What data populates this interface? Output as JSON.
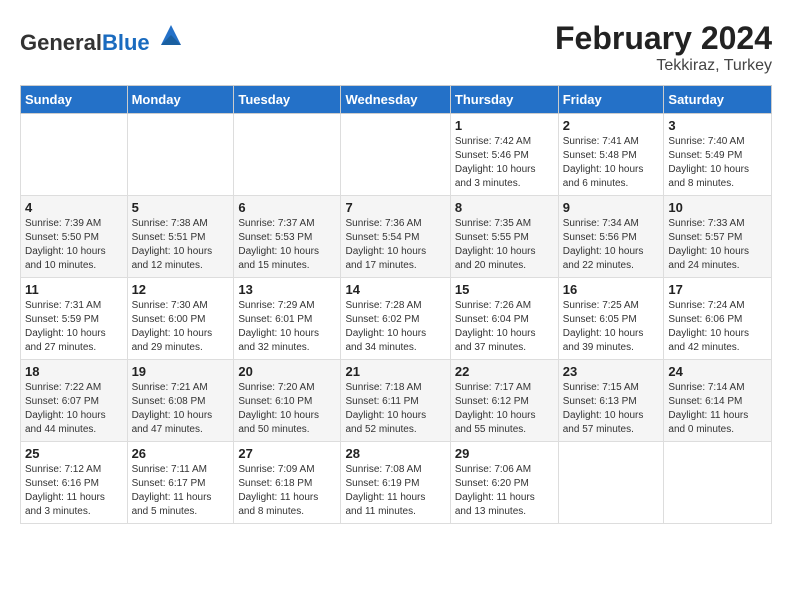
{
  "header": {
    "logo_general": "General",
    "logo_blue": "Blue",
    "month_year": "February 2024",
    "location": "Tekkiraz, Turkey"
  },
  "days_of_week": [
    "Sunday",
    "Monday",
    "Tuesday",
    "Wednesday",
    "Thursday",
    "Friday",
    "Saturday"
  ],
  "weeks": [
    [
      {
        "day": "",
        "info": ""
      },
      {
        "day": "",
        "info": ""
      },
      {
        "day": "",
        "info": ""
      },
      {
        "day": "",
        "info": ""
      },
      {
        "day": "1",
        "info": "Sunrise: 7:42 AM\nSunset: 5:46 PM\nDaylight: 10 hours\nand 3 minutes."
      },
      {
        "day": "2",
        "info": "Sunrise: 7:41 AM\nSunset: 5:48 PM\nDaylight: 10 hours\nand 6 minutes."
      },
      {
        "day": "3",
        "info": "Sunrise: 7:40 AM\nSunset: 5:49 PM\nDaylight: 10 hours\nand 8 minutes."
      }
    ],
    [
      {
        "day": "4",
        "info": "Sunrise: 7:39 AM\nSunset: 5:50 PM\nDaylight: 10 hours\nand 10 minutes."
      },
      {
        "day": "5",
        "info": "Sunrise: 7:38 AM\nSunset: 5:51 PM\nDaylight: 10 hours\nand 12 minutes."
      },
      {
        "day": "6",
        "info": "Sunrise: 7:37 AM\nSunset: 5:53 PM\nDaylight: 10 hours\nand 15 minutes."
      },
      {
        "day": "7",
        "info": "Sunrise: 7:36 AM\nSunset: 5:54 PM\nDaylight: 10 hours\nand 17 minutes."
      },
      {
        "day": "8",
        "info": "Sunrise: 7:35 AM\nSunset: 5:55 PM\nDaylight: 10 hours\nand 20 minutes."
      },
      {
        "day": "9",
        "info": "Sunrise: 7:34 AM\nSunset: 5:56 PM\nDaylight: 10 hours\nand 22 minutes."
      },
      {
        "day": "10",
        "info": "Sunrise: 7:33 AM\nSunset: 5:57 PM\nDaylight: 10 hours\nand 24 minutes."
      }
    ],
    [
      {
        "day": "11",
        "info": "Sunrise: 7:31 AM\nSunset: 5:59 PM\nDaylight: 10 hours\nand 27 minutes."
      },
      {
        "day": "12",
        "info": "Sunrise: 7:30 AM\nSunset: 6:00 PM\nDaylight: 10 hours\nand 29 minutes."
      },
      {
        "day": "13",
        "info": "Sunrise: 7:29 AM\nSunset: 6:01 PM\nDaylight: 10 hours\nand 32 minutes."
      },
      {
        "day": "14",
        "info": "Sunrise: 7:28 AM\nSunset: 6:02 PM\nDaylight: 10 hours\nand 34 minutes."
      },
      {
        "day": "15",
        "info": "Sunrise: 7:26 AM\nSunset: 6:04 PM\nDaylight: 10 hours\nand 37 minutes."
      },
      {
        "day": "16",
        "info": "Sunrise: 7:25 AM\nSunset: 6:05 PM\nDaylight: 10 hours\nand 39 minutes."
      },
      {
        "day": "17",
        "info": "Sunrise: 7:24 AM\nSunset: 6:06 PM\nDaylight: 10 hours\nand 42 minutes."
      }
    ],
    [
      {
        "day": "18",
        "info": "Sunrise: 7:22 AM\nSunset: 6:07 PM\nDaylight: 10 hours\nand 44 minutes."
      },
      {
        "day": "19",
        "info": "Sunrise: 7:21 AM\nSunset: 6:08 PM\nDaylight: 10 hours\nand 47 minutes."
      },
      {
        "day": "20",
        "info": "Sunrise: 7:20 AM\nSunset: 6:10 PM\nDaylight: 10 hours\nand 50 minutes."
      },
      {
        "day": "21",
        "info": "Sunrise: 7:18 AM\nSunset: 6:11 PM\nDaylight: 10 hours\nand 52 minutes."
      },
      {
        "day": "22",
        "info": "Sunrise: 7:17 AM\nSunset: 6:12 PM\nDaylight: 10 hours\nand 55 minutes."
      },
      {
        "day": "23",
        "info": "Sunrise: 7:15 AM\nSunset: 6:13 PM\nDaylight: 10 hours\nand 57 minutes."
      },
      {
        "day": "24",
        "info": "Sunrise: 7:14 AM\nSunset: 6:14 PM\nDaylight: 11 hours\nand 0 minutes."
      }
    ],
    [
      {
        "day": "25",
        "info": "Sunrise: 7:12 AM\nSunset: 6:16 PM\nDaylight: 11 hours\nand 3 minutes."
      },
      {
        "day": "26",
        "info": "Sunrise: 7:11 AM\nSunset: 6:17 PM\nDaylight: 11 hours\nand 5 minutes."
      },
      {
        "day": "27",
        "info": "Sunrise: 7:09 AM\nSunset: 6:18 PM\nDaylight: 11 hours\nand 8 minutes."
      },
      {
        "day": "28",
        "info": "Sunrise: 7:08 AM\nSunset: 6:19 PM\nDaylight: 11 hours\nand 11 minutes."
      },
      {
        "day": "29",
        "info": "Sunrise: 7:06 AM\nSunset: 6:20 PM\nDaylight: 11 hours\nand 13 minutes."
      },
      {
        "day": "",
        "info": ""
      },
      {
        "day": "",
        "info": ""
      }
    ]
  ]
}
